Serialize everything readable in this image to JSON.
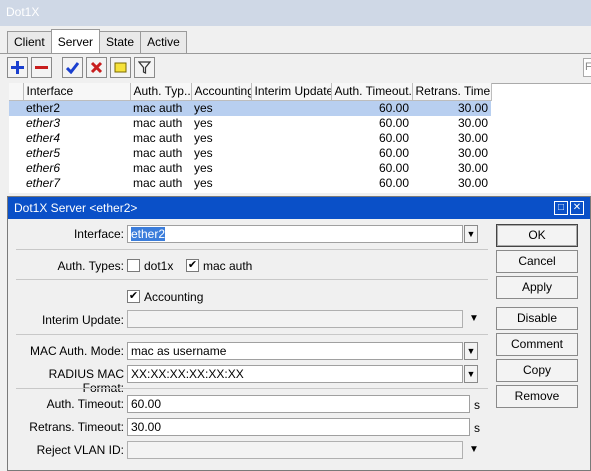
{
  "window": {
    "title": "Dot1X"
  },
  "tabs": [
    "Client",
    "Server",
    "State",
    "Active"
  ],
  "active_tab": "Server",
  "search": {
    "placeholder": "F"
  },
  "table": {
    "columns": [
      "Interface",
      "Auth. Typ...",
      "Accounting",
      "Interim Update",
      "Auth. Timeout...",
      "Retrans. Time..."
    ],
    "rows": [
      [
        "ether2",
        "mac auth",
        "yes",
        "",
        "60.00",
        "30.00"
      ],
      [
        "ether3",
        "mac auth",
        "yes",
        "",
        "60.00",
        "30.00"
      ],
      [
        "ether4",
        "mac auth",
        "yes",
        "",
        "60.00",
        "30.00"
      ],
      [
        "ether5",
        "mac auth",
        "yes",
        "",
        "60.00",
        "30.00"
      ],
      [
        "ether6",
        "mac auth",
        "yes",
        "",
        "60.00",
        "30.00"
      ],
      [
        "ether7",
        "mac auth",
        "yes",
        "",
        "60.00",
        "30.00"
      ]
    ],
    "selected_row": 0
  },
  "dialog": {
    "title": "Dot1X Server <ether2>",
    "labels": {
      "interface": "Interface:",
      "auth_types": "Auth. Types:",
      "interim_update": "Interim Update:",
      "mac_auth_mode": "MAC Auth. Mode:",
      "radius_mac_format": "RADIUS MAC Format:",
      "auth_timeout": "Auth. Timeout:",
      "retrans_timeout": "Retrans. Timeout:",
      "reject_vlan_id": "Reject VLAN ID:"
    },
    "values": {
      "interface": "ether2",
      "mac_auth_mode": "mac as username",
      "radius_mac_format": "XX:XX:XX:XX:XX:XX",
      "auth_timeout": "60.00",
      "retrans_timeout": "30.00",
      "interim_update": "",
      "reject_vlan_id": ""
    },
    "checkboxes": {
      "dot1x": {
        "label": "dot1x",
        "checked": false
      },
      "mac_auth": {
        "label": "mac auth",
        "checked": true
      },
      "accounting": {
        "label": "Accounting",
        "checked": true
      }
    },
    "unit": "s",
    "buttons": [
      "OK",
      "Cancel",
      "Apply",
      "Disable",
      "Comment",
      "Copy",
      "Remove"
    ]
  },
  "colors": {
    "selection": "#b8cff0",
    "dialog_title": "#0a50c8",
    "add": "#1a3fcf",
    "remove": "#c81e1e"
  }
}
